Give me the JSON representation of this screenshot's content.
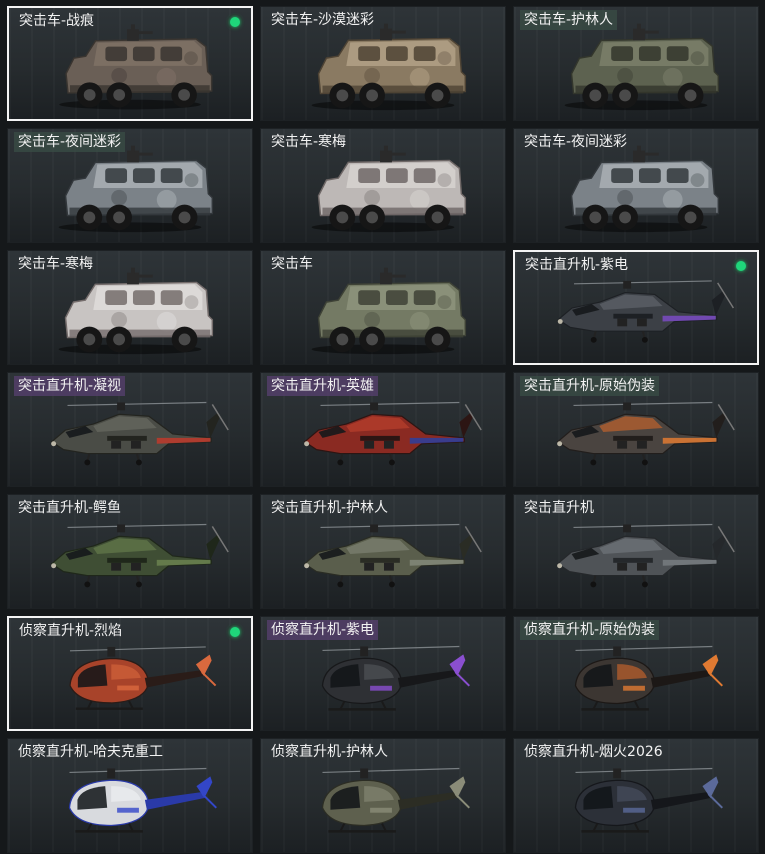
{
  "items": [
    {
      "label": "突击车-战痕",
      "kind": "truck",
      "tag": "none",
      "selected": true,
      "equipped": true,
      "palette": {
        "body": "#6a5f56",
        "light": "#8b7c6f",
        "dark": "#3a3530"
      }
    },
    {
      "label": "突击车-沙漠迷彩",
      "kind": "truck",
      "tag": "none",
      "selected": false,
      "equipped": false,
      "palette": {
        "body": "#8a7a62",
        "light": "#c8b79b",
        "dark": "#4e4334"
      }
    },
    {
      "label": "突击车-护林人",
      "kind": "truck",
      "tag": "green",
      "selected": false,
      "equipped": false,
      "palette": {
        "body": "#5d6250",
        "light": "#8c9078",
        "dark": "#33362c"
      }
    },
    {
      "label": "突击车-夜间迷彩",
      "kind": "truck",
      "tag": "green",
      "selected": false,
      "equipped": false,
      "palette": {
        "body": "#7b8288",
        "light": "#c4cace",
        "dark": "#33383c"
      }
    },
    {
      "label": "突击车-寒梅",
      "kind": "truck",
      "tag": "none",
      "selected": false,
      "equipped": false,
      "palette": {
        "body": "#bdb8b6",
        "light": "#e6e2df",
        "dark": "#6e6766"
      }
    },
    {
      "label": "突击车-夜间迷彩",
      "kind": "truck",
      "tag": "none",
      "selected": false,
      "equipped": false,
      "palette": {
        "body": "#7b8288",
        "light": "#c4cace",
        "dark": "#33383c"
      }
    },
    {
      "label": "突击车-寒梅",
      "kind": "truck",
      "tag": "none",
      "selected": false,
      "equipped": false,
      "palette": {
        "body": "#c8c4c2",
        "light": "#ecebea",
        "dark": "#746c6b"
      }
    },
    {
      "label": "突击车",
      "kind": "truck",
      "tag": "none",
      "selected": false,
      "equipped": false,
      "palette": {
        "body": "#747a64",
        "light": "#9da38a",
        "dark": "#3e4236"
      }
    },
    {
      "label": "突击直升机-紫电",
      "kind": "heli",
      "tag": "none",
      "selected": true,
      "equipped": true,
      "palette": {
        "body": "#3c4046",
        "light": "#666b72",
        "dark": "#1d2024",
        "accent": "#7a4bc4"
      }
    },
    {
      "label": "突击直升机-凝视",
      "kind": "heli",
      "tag": "purple",
      "selected": false,
      "equipped": false,
      "palette": {
        "body": "#4a4c46",
        "light": "#6e7066",
        "dark": "#23241f",
        "accent": "#c0392b"
      }
    },
    {
      "label": "突击直升机-英雄",
      "kind": "heli",
      "tag": "purple",
      "selected": false,
      "equipped": false,
      "palette": {
        "body": "#8a2a22",
        "light": "#c2452f",
        "dark": "#2c1513",
        "accent": "#2b3fa0"
      }
    },
    {
      "label": "突击直升机-原始伪装",
      "kind": "heli",
      "tag": "green",
      "selected": false,
      "equipped": false,
      "palette": {
        "body": "#4a4440",
        "light": "#d4672a",
        "dark": "#221e1c",
        "accent": "#e07a32"
      }
    },
    {
      "label": "突击直升机-鳄鱼",
      "kind": "heli",
      "tag": "none",
      "selected": false,
      "equipped": false,
      "palette": {
        "body": "#3f4e34",
        "light": "#6b8250",
        "dark": "#1f271a",
        "accent": "#6b8250"
      }
    },
    {
      "label": "突击直升机-护林人",
      "kind": "heli",
      "tag": "none",
      "selected": false,
      "equipped": false,
      "palette": {
        "body": "#5a5e4c",
        "light": "#84887a",
        "dark": "#2a2c24",
        "accent": "#84887a"
      }
    },
    {
      "label": "突击直升机",
      "kind": "heli",
      "tag": "none",
      "selected": false,
      "equipped": false,
      "palette": {
        "body": "#4f5357",
        "light": "#777c80",
        "dark": "#25282b",
        "accent": "#777c80"
      }
    },
    {
      "label": "侦察直升机-烈焰",
      "kind": "scout",
      "tag": "none",
      "selected": true,
      "equipped": true,
      "palette": {
        "body": "#a8432a",
        "light": "#d9693e",
        "dark": "#2a1c18",
        "accent": "#d9693e"
      }
    },
    {
      "label": "侦察直升机-紫电",
      "kind": "scout",
      "tag": "purple",
      "selected": false,
      "equipped": false,
      "palette": {
        "body": "#2e3034",
        "light": "#55585e",
        "dark": "#17181a",
        "accent": "#8a4fd0"
      }
    },
    {
      "label": "侦察直升机-原始伪装",
      "kind": "scout",
      "tag": "green",
      "selected": false,
      "equipped": false,
      "palette": {
        "body": "#3c3632",
        "light": "#d6692a",
        "dark": "#1c1816",
        "accent": "#e07a32"
      }
    },
    {
      "label": "侦察直升机-哈夫克重工",
      "kind": "scout",
      "tag": "none",
      "selected": false,
      "equipped": false,
      "palette": {
        "body": "#d8dade",
        "light": "#f2f3f5",
        "dark": "#2a3aa8",
        "accent": "#3346c8"
      }
    },
    {
      "label": "侦察直升机-护林人",
      "kind": "scout",
      "tag": "none",
      "selected": false,
      "equipped": false,
      "palette": {
        "body": "#5e604e",
        "light": "#8a8c78",
        "dark": "#2c2d24",
        "accent": "#8a8c78"
      }
    },
    {
      "label": "侦察直升机-烟火2026",
      "kind": "scout",
      "tag": "none",
      "selected": false,
      "equipped": false,
      "palette": {
        "body": "#2c3038",
        "light": "#4c5466",
        "dark": "#15171b",
        "accent": "#5b6a9a"
      }
    }
  ]
}
